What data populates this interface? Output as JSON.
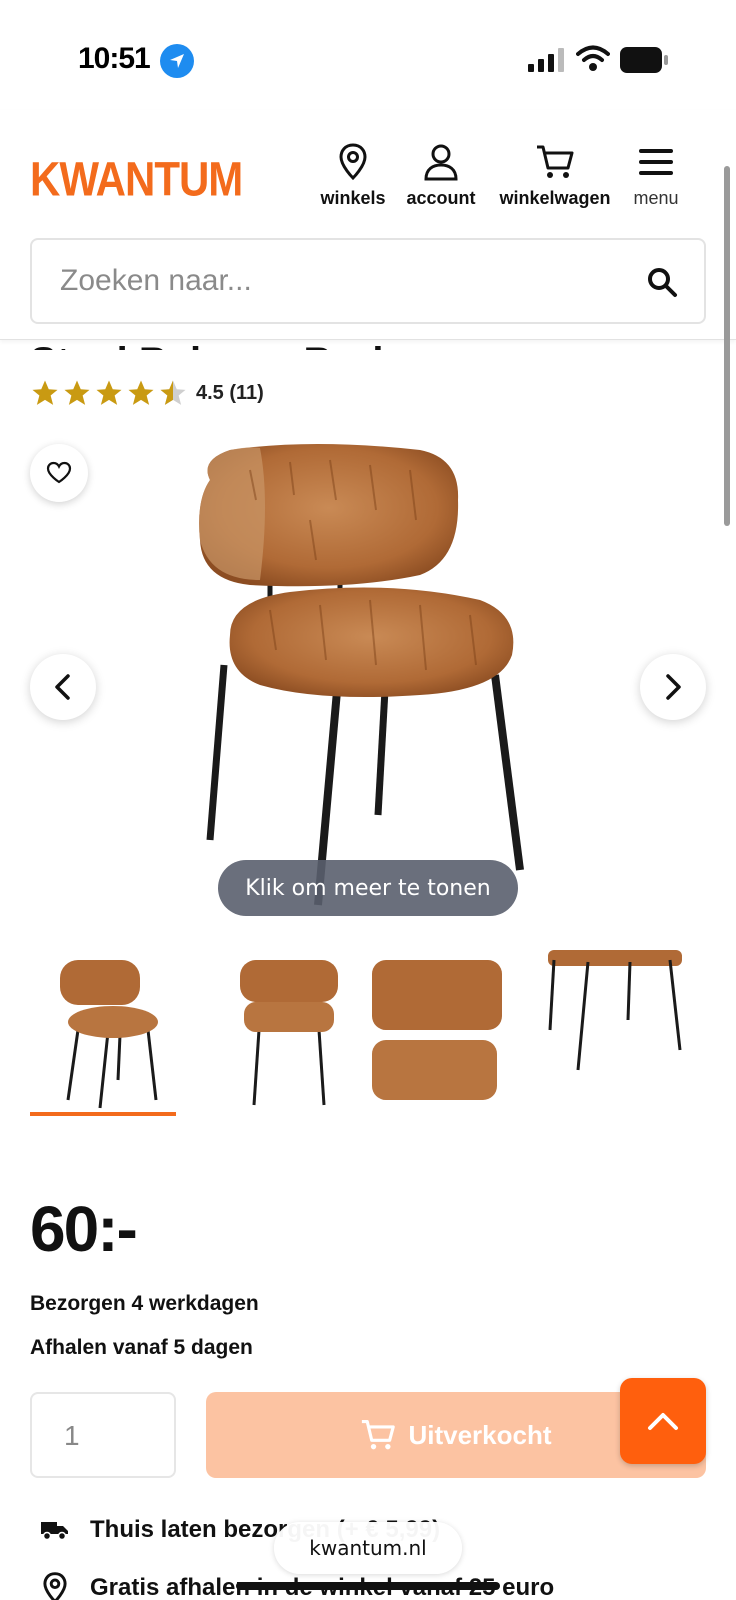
{
  "status_bar": {
    "time": "10:51"
  },
  "header": {
    "logo": "KWANTUM",
    "nav": [
      {
        "label": "winkels",
        "icon": "location-pin-icon"
      },
      {
        "label": "account",
        "icon": "user-icon"
      },
      {
        "label": "winkelwagen",
        "icon": "cart-icon"
      },
      {
        "label": "menu",
        "icon": "hamburger-menu-icon"
      }
    ],
    "search_placeholder": "Zoeken naar..."
  },
  "product": {
    "title_fragment": "Stoel Belsana Bruin",
    "rating_value": 4.5,
    "rating_text": "4.5 (11)",
    "image_overlay": "Klik om meer te tonen",
    "thumbnail_count": 4,
    "active_thumbnail": 1,
    "price": "60",
    "price_suffix": ":-",
    "delivery": "Bezorgen 4 werkdagen",
    "pickup": "Afhalen vanaf 5 dagen",
    "quantity": "1",
    "cart_button": "Uitverkocht"
  },
  "usps": [
    {
      "icon": "truck-icon",
      "text": "Thuis laten bezorgen (+ € 5,99)"
    },
    {
      "icon": "location-pin-icon",
      "text": "Gratis afhalen in de winkel vanaf 25 euro"
    }
  ],
  "browser": {
    "url": "kwantum.nl"
  },
  "colors": {
    "brand": "#f36b1c",
    "cart_disabled": "#fcc3a2",
    "scroll_top": "#ff5f0d",
    "star": "#c99a12"
  }
}
